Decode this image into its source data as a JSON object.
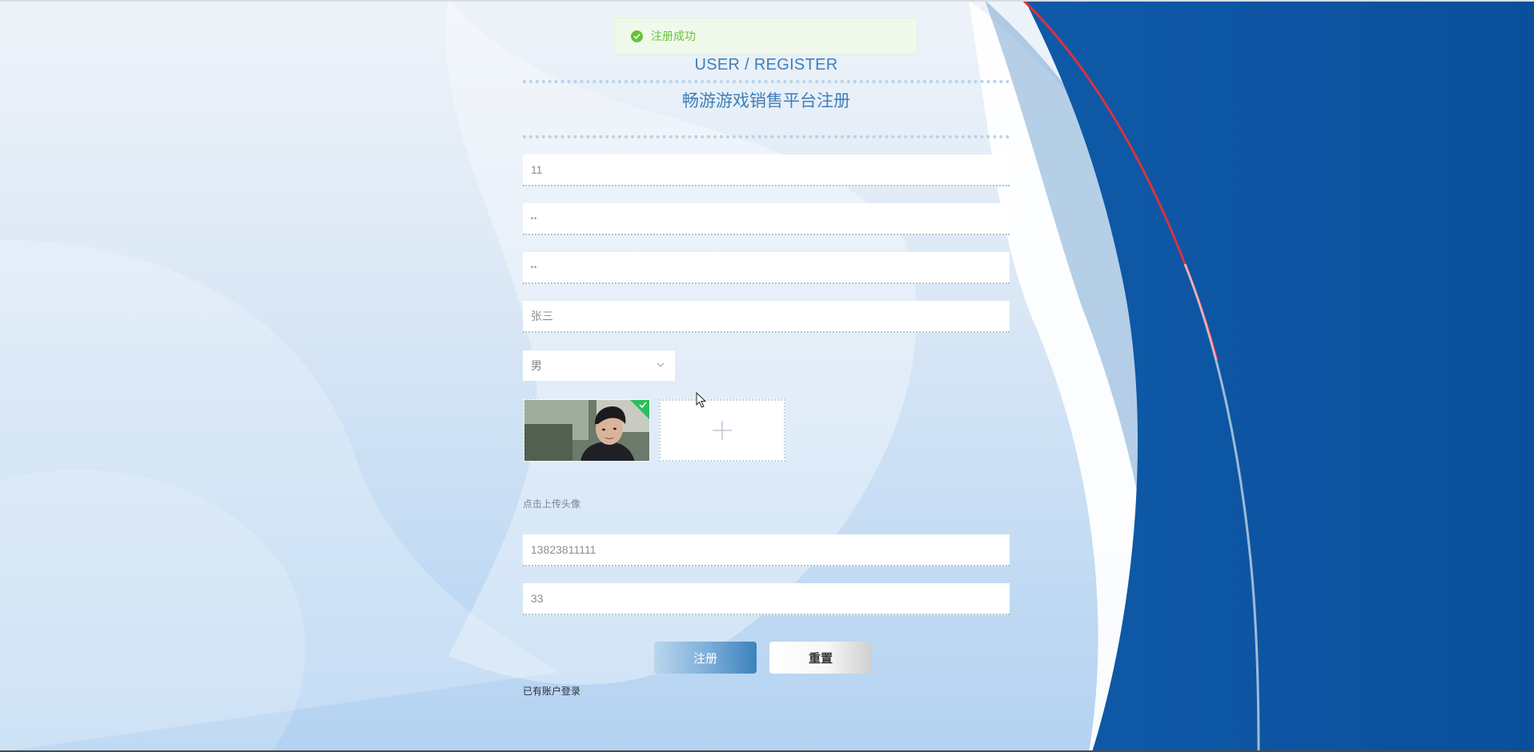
{
  "toast": {
    "message": "注册成功",
    "icon": "check-circle-icon",
    "color": "#67c23a"
  },
  "header": {
    "title_en": "USER / REGISTER",
    "title_cn": "畅游游戏销售平台注册"
  },
  "form": {
    "account_value": "11",
    "password_value": "••",
    "confirm_password_value": "••",
    "name_value": "张三",
    "gender": {
      "selected": "男"
    },
    "avatar": {
      "upload_icon": "plus-icon",
      "hint": "点击上传头像"
    },
    "phone_value": "13823811111",
    "age_value": "33"
  },
  "buttons": {
    "register_label": "注册",
    "reset_label": "重置"
  },
  "login_link": "已有账户登录",
  "colors": {
    "brand_blue": "#3e7fb8",
    "deep_blue": "#0a52a0",
    "accent_red": "#d9333f"
  }
}
